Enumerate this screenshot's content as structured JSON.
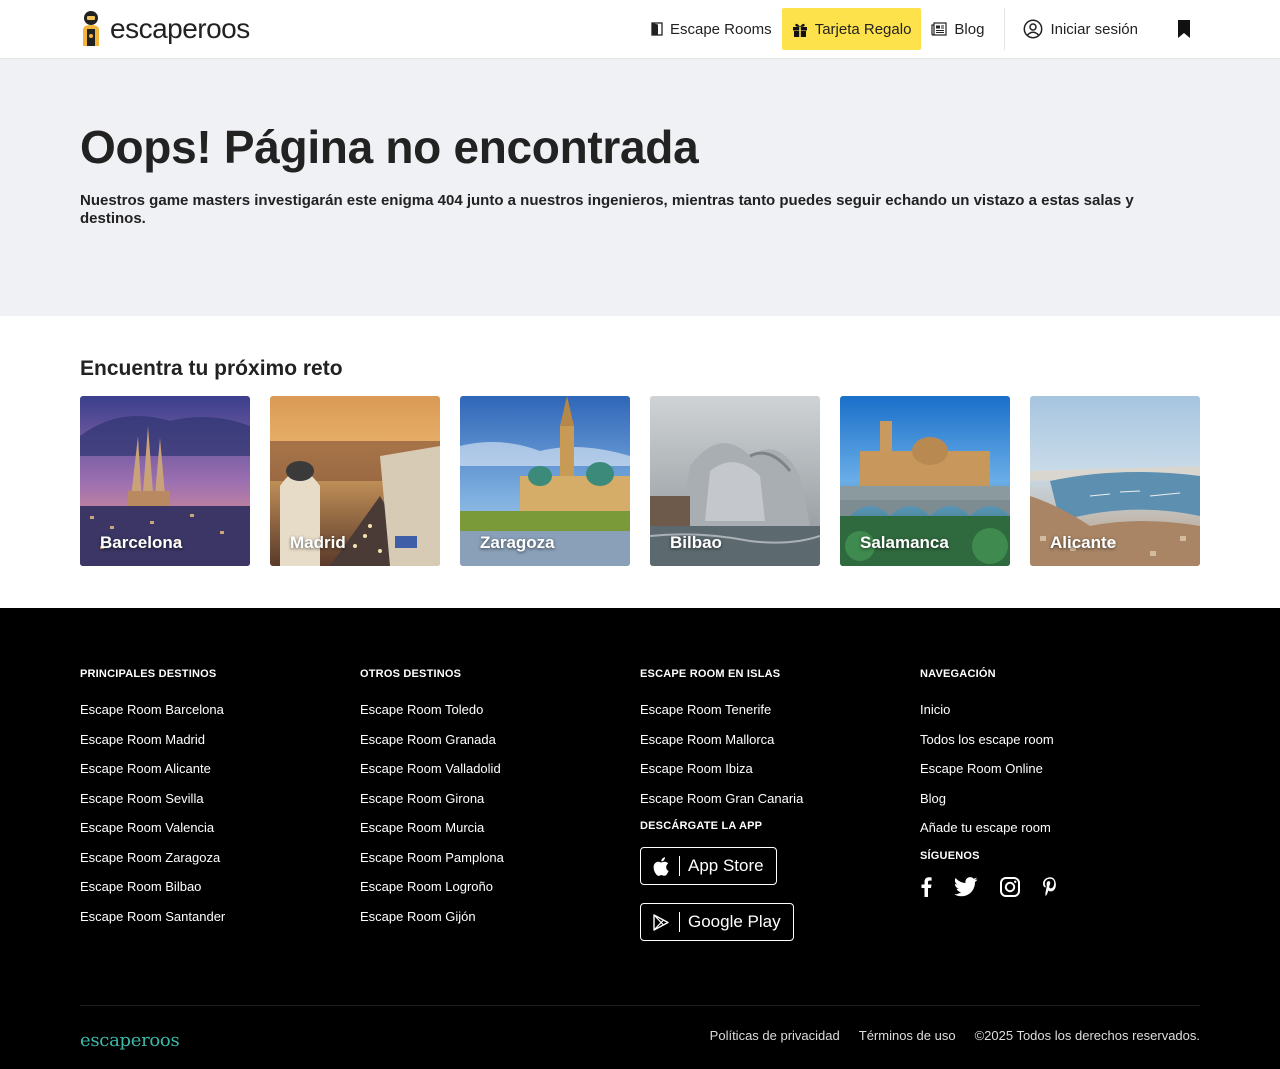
{
  "header": {
    "logo_text": "escaperoos",
    "nav": {
      "escape_rooms": "Escape Rooms",
      "gift_card": "Tarjeta Regalo",
      "blog": "Blog",
      "login": "Iniciar sesión"
    }
  },
  "hero": {
    "title": "Oops! Página no encontrada",
    "subtitle": "Nuestros game masters investigarán este enigma 404 junto a nuestros ingenieros, mientras tanto puedes seguir echando un vistazo a estas salas y destinos."
  },
  "cities": {
    "heading": "Encuentra tu próximo reto",
    "items": [
      {
        "name": "Barcelona"
      },
      {
        "name": "Madrid"
      },
      {
        "name": "Zaragoza"
      },
      {
        "name": "Bilbao"
      },
      {
        "name": "Salamanca"
      },
      {
        "name": "Alicante"
      }
    ]
  },
  "footer": {
    "principales": {
      "title": "PRINCIPALES DESTINOS",
      "links": [
        "Escape Room Barcelona",
        "Escape Room Madrid",
        "Escape Room Alicante",
        "Escape Room Sevilla",
        "Escape Room Valencia",
        "Escape Room Zaragoza",
        "Escape Room Bilbao",
        "Escape Room Santander"
      ]
    },
    "otros": {
      "title": "OTROS DESTINOS",
      "links": [
        "Escape Room Toledo",
        "Escape Room Granada",
        "Escape Room Valladolid",
        "Escape Room Girona",
        "Escape Room Murcia",
        "Escape Room Pamplona",
        "Escape Room Logroño",
        "Escape Room Gijón"
      ]
    },
    "islas": {
      "title": "ESCAPE ROOM EN ISLAS",
      "links": [
        "Escape Room Tenerife",
        "Escape Room Mallorca",
        "Escape Room Ibiza",
        "Escape Room Gran Canaria"
      ]
    },
    "app": {
      "title": "DESCÁRGATE LA APP",
      "app_store": "App Store",
      "google_play": "Google Play"
    },
    "navegacion": {
      "title": "NAVEGACIÓN",
      "links": [
        "Inicio",
        "Todos los escape room",
        "Escape Room Online",
        "Blog",
        "Añade tu escape room"
      ]
    },
    "siguenos": {
      "title": "SÍGUENOS",
      "networks": [
        "facebook-icon",
        "twitter-icon",
        "instagram-icon",
        "pinterest-icon"
      ]
    },
    "bottom": {
      "logo_text": "escaperoos",
      "privacy": "Políticas de privacidad",
      "terms": "Términos de uso",
      "copyright": "©2025 Todos los derechos reservados."
    }
  },
  "colors": {
    "gift_highlight": "#fde24b",
    "hero_bg": "#f0f1f5",
    "footer_bg": "#000000",
    "footer_logo": "#3bb8a8"
  }
}
